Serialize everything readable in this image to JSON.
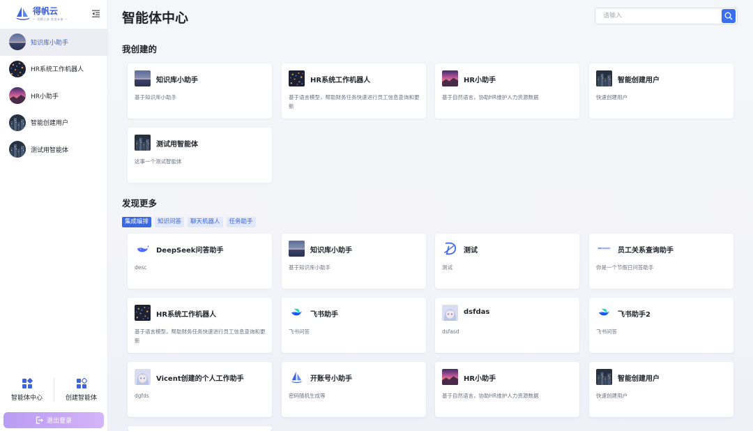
{
  "brand": {
    "name": "得帆云",
    "tagline": "— 信赖之选 智造未来 —",
    "accent": "#3d63dd"
  },
  "sidebar": {
    "items": [
      {
        "label": "知识库小助手",
        "avatar": "lake-dusk",
        "active": true
      },
      {
        "label": "HR系统工作机器人",
        "avatar": "fireworks",
        "active": false
      },
      {
        "label": "HR小助手",
        "avatar": "sunset-pink",
        "active": false
      },
      {
        "label": "智能创建用户",
        "avatar": "city-night",
        "active": false
      },
      {
        "label": "测试用智能体",
        "avatar": "city-night",
        "active": false
      }
    ],
    "bottom": {
      "agent_center": "智能体中心",
      "create_agent": "创建智能体"
    },
    "logout": "退出登录"
  },
  "header": {
    "title": "智能体中心",
    "search_placeholder": "请输入"
  },
  "mine": {
    "title": "我创建的",
    "cards": [
      {
        "name": "知识库小助手",
        "desc": "基于知识库小助手",
        "thumb": "lake-dusk"
      },
      {
        "name": "HR系统工作机器人",
        "desc": "基于语言模型，帮助财务任务快速进行员工信息查询和更新",
        "thumb": "fireworks"
      },
      {
        "name": "HR小助手",
        "desc": "基于自然语言，协助HR维护人力资源数据",
        "thumb": "sunset-pink"
      },
      {
        "name": "智能创建用户",
        "desc": "快速创建用户",
        "thumb": "city-night"
      },
      {
        "name": "测试用智能体",
        "desc": "这事一个测试智能体",
        "thumb": "city-night"
      }
    ]
  },
  "discover": {
    "title": "发现更多",
    "tags": [
      {
        "label": "集成编排",
        "active": true
      },
      {
        "label": "知识问答",
        "active": false
      },
      {
        "label": "聊天机器人",
        "active": false
      },
      {
        "label": "任务助手",
        "active": false
      }
    ],
    "cards": [
      {
        "name": "DeepSeek问答助手",
        "desc": "desc",
        "thumb": "whale-icon"
      },
      {
        "name": "知识库小助手",
        "desc": "基于知识库小助手",
        "thumb": "lake-dusk"
      },
      {
        "name": "测试",
        "desc": "测试",
        "thumb": "d-logo-icon"
      },
      {
        "name": "员工关系查询助手",
        "desc": "你是一个节假日问答助手",
        "thumb": "brand-logo-small"
      },
      {
        "name": "HR系统工作机器人",
        "desc": "基于语言模型，帮助财务任务快速进行员工信息查询和更新",
        "thumb": "fireworks"
      },
      {
        "name": "飞书助手",
        "desc": "飞书问答",
        "thumb": "feishu-icon"
      },
      {
        "name": "dsfdas",
        "desc": "dsfasd",
        "thumb": "anime-avatar"
      },
      {
        "name": "飞书助手2",
        "desc": "飞书问答",
        "thumb": "feishu-icon"
      },
      {
        "name": "Vicent创建的个人工作助手",
        "desc": "dgfds",
        "thumb": "anime-avatar"
      },
      {
        "name": "开账号小助手",
        "desc": "密码随机生成等",
        "thumb": "sail-icon"
      },
      {
        "name": "HR小助手",
        "desc": "基于自然语言，协助HR维护人力资源数据",
        "thumb": "sunset-pink"
      },
      {
        "name": "智能创建用户",
        "desc": "快速创建用户",
        "thumb": "city-night"
      }
    ]
  }
}
